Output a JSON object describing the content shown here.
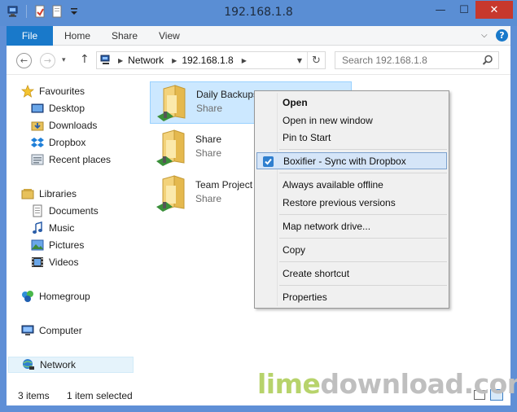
{
  "window": {
    "title": "192.168.1.8",
    "controls": {
      "minimize": "—",
      "maximize": "☐",
      "close": "✕"
    }
  },
  "ribbon": {
    "file_tab": "File",
    "tabs": [
      "Home",
      "Share",
      "View"
    ],
    "help": "?"
  },
  "navigation": {
    "back": "←",
    "forward": "→",
    "up": "↑",
    "breadcrumb": [
      "Network",
      "192.168.1.8"
    ],
    "refresh": "↻",
    "search_placeholder": "Search 192.168.1.8"
  },
  "sidebar": {
    "favourites": {
      "label": "Favourites",
      "items": [
        "Desktop",
        "Downloads",
        "Dropbox",
        "Recent places"
      ]
    },
    "libraries": {
      "label": "Libraries",
      "items": [
        "Documents",
        "Music",
        "Pictures",
        "Videos"
      ]
    },
    "homegroup": "Homegroup",
    "computer": "Computer",
    "network": "Network"
  },
  "files": [
    {
      "name": "Daily Backups",
      "sub": "Share",
      "selected": true
    },
    {
      "name": "Share",
      "sub": "Share",
      "selected": false
    },
    {
      "name": "Team Project",
      "sub": "Share",
      "selected": false
    }
  ],
  "context_menu": {
    "open": "Open",
    "open_new_window": "Open in new window",
    "pin_to_start": "Pin to Start",
    "boxifier": "Boxifier - Sync with Dropbox",
    "always_offline": "Always available offline",
    "restore_versions": "Restore previous versions",
    "map_drive": "Map network drive...",
    "copy": "Copy",
    "create_shortcut": "Create shortcut",
    "properties": "Properties"
  },
  "status": {
    "items_count": "3 items",
    "selected_count": "1 item selected"
  },
  "watermark": {
    "part1": "lime",
    "part2": "download.com"
  },
  "colors": {
    "titlebar": "#5a8ed4",
    "file_tab": "#1979ca",
    "selection": "#cce8ff",
    "close": "#c7382d"
  }
}
